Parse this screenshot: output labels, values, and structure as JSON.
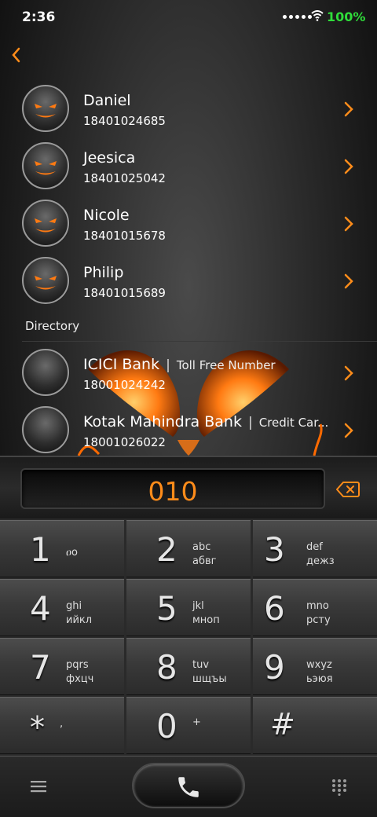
{
  "status": {
    "time": "2:36",
    "battery": "100%"
  },
  "contacts": [
    {
      "name": "Daniel",
      "number": "18401024685"
    },
    {
      "name": "Jeesica",
      "number": "18401025042"
    },
    {
      "name": "Nicole",
      "number": "18401015678"
    },
    {
      "name": "Philip",
      "number": "18401015689"
    }
  ],
  "directory_label": "Directory",
  "directory": [
    {
      "name": "ICICI Bank",
      "tag": "Toll Free Number",
      "number": "18001024242"
    },
    {
      "name": "Kotak Mahindra Bank",
      "tag": "Credit Car...",
      "number": "18001026022"
    }
  ],
  "dialed": "010",
  "keys": [
    {
      "num": "1",
      "l1": "ዐo",
      "l2": ""
    },
    {
      "num": "2",
      "l1": "abc",
      "l2": "абвг"
    },
    {
      "num": "3",
      "l1": "def",
      "l2": "дежз"
    },
    {
      "num": "4",
      "l1": "ghi",
      "l2": "ийкл"
    },
    {
      "num": "5",
      "l1": "jkl",
      "l2": "мноп"
    },
    {
      "num": "6",
      "l1": "mno",
      "l2": "рсту"
    },
    {
      "num": "7",
      "l1": "pqrs",
      "l2": "фхцч"
    },
    {
      "num": "8",
      "l1": "tuv",
      "l2": "шщъы"
    },
    {
      "num": "9",
      "l1": "wxyz",
      "l2": "ьэюя"
    },
    {
      "num": "*",
      "l1": ",",
      "l2": ""
    },
    {
      "num": "0",
      "l1": "+",
      "l2": ""
    },
    {
      "num": "#",
      "l1": "",
      "l2": ""
    }
  ],
  "colors": {
    "accent": "#ff8c1a",
    "battery": "#2fdc3a"
  },
  "icons": {
    "back": "chevron-left-icon",
    "delete": "backspace-icon",
    "menu": "menu-icon",
    "call": "phone-icon",
    "dialpad": "dialpad-icon"
  }
}
